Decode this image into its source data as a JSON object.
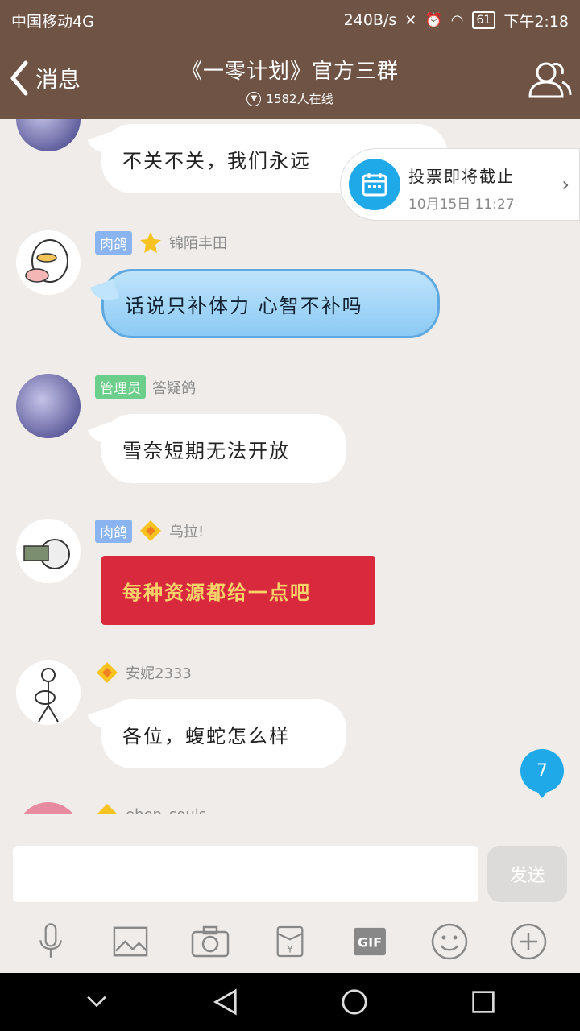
{
  "status_bar": {
    "carrier": "中国移动4G",
    "speed": "240B/s",
    "battery": "61",
    "time": "下午2:18"
  },
  "header": {
    "back_label": "消息",
    "title": "《一零计划》官方三群",
    "online": "1582人在线"
  },
  "notice": {
    "title": "投票即将截止",
    "time": "10月15日 11:27"
  },
  "messages": [
    {
      "text": "不关不关，我们永远"
    },
    {
      "tag": "肉鸽",
      "name": "锦陌丰田",
      "text": "话说只补体力 心智不补吗"
    },
    {
      "tag": "管理员",
      "name": "答疑鸽",
      "text": "雪奈短期无法开放"
    },
    {
      "tag": "肉鸽",
      "name": "乌拉!",
      "text": "每种资源都给一点吧"
    },
    {
      "name": "安妮2333",
      "text": "各位，蝮蛇怎么样"
    },
    {
      "name": "ehen_souls"
    }
  ],
  "unread_count": "7",
  "input": {
    "placeholder": "",
    "send_label": "发送"
  },
  "colors": {
    "header": "#6f5344",
    "accent": "#1fa9e8"
  }
}
